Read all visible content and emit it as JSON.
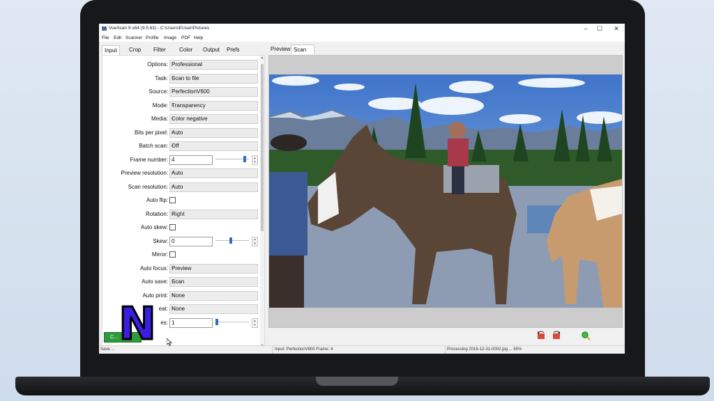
{
  "window": {
    "title": "VueScan 9 x64 (9.5.63) - C:\\Users\\EUser\\Pictures",
    "minimize_glyph": "–",
    "maximize_glyph": "☐",
    "close_glyph": "✕"
  },
  "menu": [
    "File",
    "Edit",
    "Scanner",
    "Profile",
    "Image",
    "PDF",
    "Help"
  ],
  "left_tabs": [
    "Input",
    "Crop",
    "Filter",
    "Color",
    "Output",
    "Prefs"
  ],
  "active_left_tab": "Input",
  "fields": {
    "options": {
      "label": "Options:",
      "value": "Professional"
    },
    "task": {
      "label": "Task:",
      "value": "Scan to file"
    },
    "source": {
      "label": "Source:",
      "value": "PerfectionV600"
    },
    "mode": {
      "label": "Mode:",
      "value": "Transparency"
    },
    "media": {
      "label": "Media:",
      "value": "Color negative"
    },
    "bits_per_pixel": {
      "label": "Bits per pixel:",
      "value": "Auto"
    },
    "batch_scan": {
      "label": "Batch scan:",
      "value": "Off"
    },
    "frame_number": {
      "label": "Frame number:",
      "value": "4"
    },
    "preview_resolution": {
      "label": "Preview resolution:",
      "value": "Auto"
    },
    "scan_resolution": {
      "label": "Scan resolution:",
      "value": "Auto"
    },
    "auto_flip": {
      "label": "Auto flip:",
      "checked": false
    },
    "rotation": {
      "label": "Rotation:",
      "value": "Right"
    },
    "auto_skew": {
      "label": "Auto skew:",
      "checked": false
    },
    "skew": {
      "label": "Skew:",
      "value": "0"
    },
    "mirror": {
      "label": "Mirror:",
      "checked": false
    },
    "auto_focus": {
      "label": "Auto focus:",
      "value": "Preview"
    },
    "auto_save": {
      "label": "Auto save:",
      "value": "Scan"
    },
    "auto_print": {
      "label": "Auto print:",
      "value": "None"
    },
    "auto_repeat": {
      "label": "eat:",
      "value": "None"
    },
    "last_row": {
      "label": "es:",
      "value": "1"
    }
  },
  "scroll_glyphs": {
    "up": "▲",
    "down": "▼"
  },
  "buttons": {
    "scan_label": "C..."
  },
  "right_tabs": [
    "Preview",
    "Scan"
  ],
  "active_right_tab": "Scan",
  "status": {
    "left": "Save ...",
    "middle": "Input: PerfectionV600 Frame: 4",
    "right": "Processing 2016-12-31-0002.jpg ... 65%"
  },
  "overlay_logo_text": "N",
  "colors": {
    "scan_button": "#2d9a3c",
    "slider_thumb": "#2d6fc2",
    "logo_fill": "#3a1fe0",
    "logo_outline": "#000000"
  },
  "icons": [
    "app-icon",
    "rotate-left-icon",
    "rotate-right-icon",
    "zoom-icon",
    "mouse-cursor-icon"
  ]
}
